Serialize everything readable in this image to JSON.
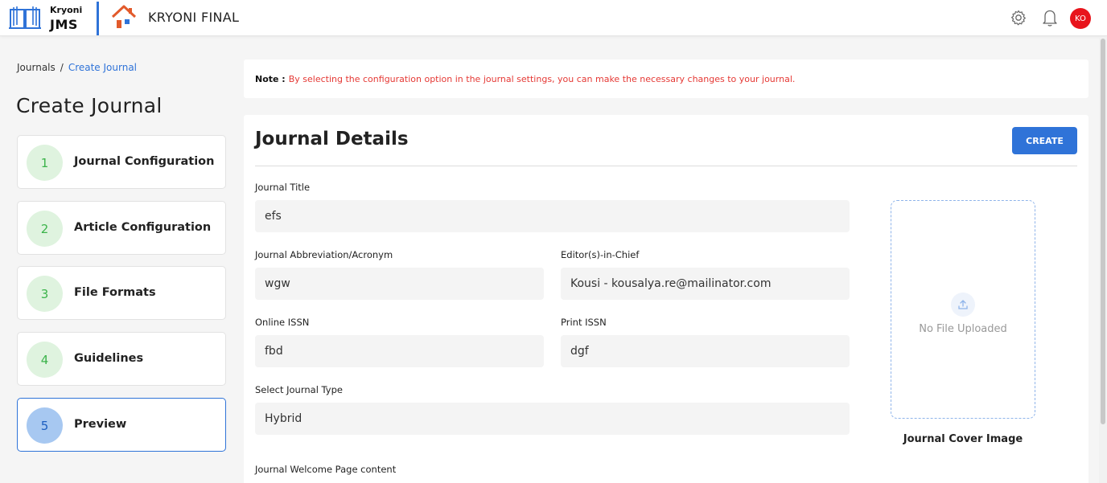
{
  "header": {
    "logo_line1": "Kryoni",
    "logo_line2": "JMS",
    "app_title": "KRYONI FINAL",
    "avatar_initials": "KO",
    "avatar_color": "#e8141c",
    "icons": [
      "book-logo-icon",
      "home-icon",
      "settings-icon",
      "bell-icon"
    ]
  },
  "breadcrumb": {
    "items": [
      "Journals",
      "Create Journal"
    ],
    "separator": "/"
  },
  "page_title": "Create Journal",
  "steps": [
    {
      "number": "1",
      "label": "Journal Configuration",
      "active": false
    },
    {
      "number": "2",
      "label": "Article Configuration",
      "active": false
    },
    {
      "number": "3",
      "label": "File Formats",
      "active": false
    },
    {
      "number": "4",
      "label": "Guidelines",
      "active": false
    },
    {
      "number": "5",
      "label": "Preview",
      "active": true
    }
  ],
  "note": {
    "label": "Note :",
    "text": "By selecting the configuration option in the journal settings, you can make the necessary changes to your journal."
  },
  "details": {
    "title": "Journal Details",
    "create_label": "CREATE",
    "fields": {
      "journal_title": {
        "label": "Journal Title",
        "value": "efs"
      },
      "abbreviation": {
        "label": "Journal Abbreviation/Acronym",
        "value": "wgw"
      },
      "editor_in_chief": {
        "label": "Editor(s)-in-Chief",
        "value": "Kousi - kousalya.re@mailinator.com"
      },
      "online_issn": {
        "label": "Online ISSN",
        "value": "fbd"
      },
      "print_issn": {
        "label": "Print ISSN",
        "value": "dgf"
      },
      "journal_type": {
        "label": "Select Journal Type",
        "value": "Hybrid"
      },
      "welcome_content": {
        "label": "Journal Welcome Page content"
      }
    },
    "cover": {
      "placeholder": "No File Uploaded",
      "label": "Journal Cover Image"
    }
  },
  "colors": {
    "accent": "#2f73d8",
    "note_text": "#e53935",
    "step_circle": "#dff3df",
    "step_active_circle": "#a7c8f1"
  }
}
